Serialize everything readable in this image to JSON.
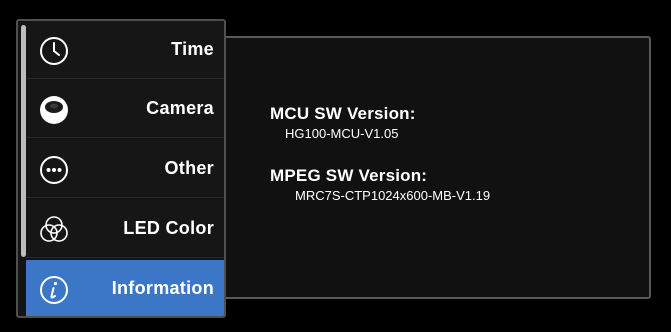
{
  "menu": {
    "items": [
      {
        "label": "Time",
        "icon": "clock-icon"
      },
      {
        "label": "Camera",
        "icon": "camera-lens-icon"
      },
      {
        "label": "Other",
        "icon": "more-dots-icon"
      },
      {
        "label": "LED Color",
        "icon": "color-circles-icon"
      },
      {
        "label": "Information",
        "icon": "info-icon",
        "selected": true
      }
    ]
  },
  "info": {
    "mcu_title": "MCU SW Version:",
    "mcu_value": "HG100-MCU-V1.05",
    "mpeg_title": "MPEG SW Version:",
    "mpeg_value": "MRC7S-CTP1024x600-MB-V1.19"
  },
  "colors": {
    "accent": "#3b77c6",
    "background": "#000000",
    "text": "#ffffff"
  }
}
